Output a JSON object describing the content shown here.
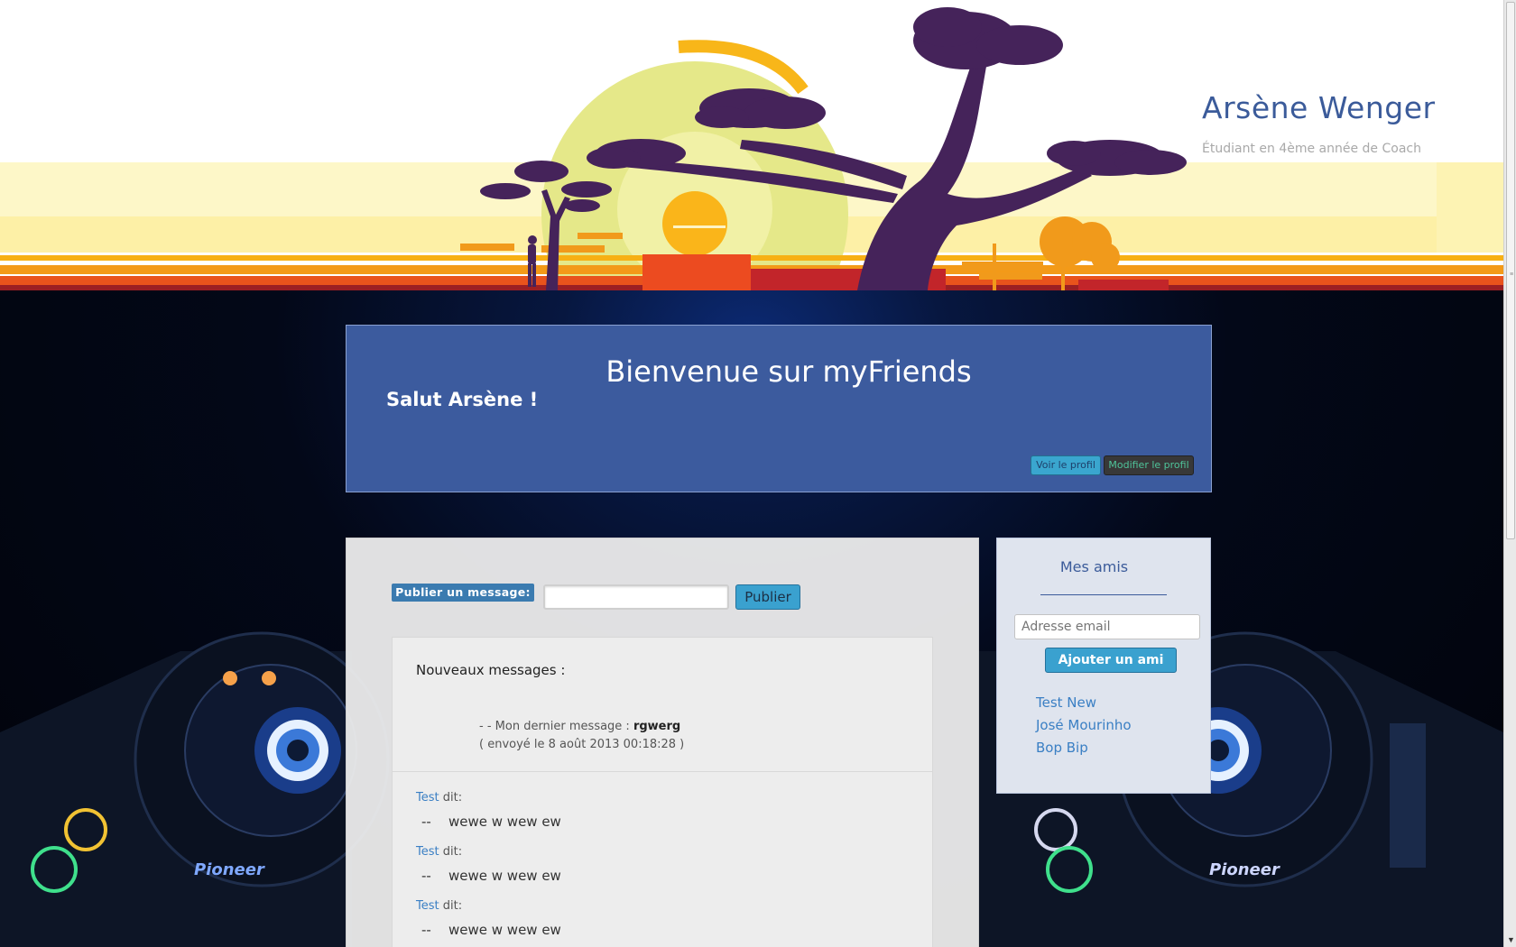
{
  "header": {
    "name": "Arsène Wenger",
    "subtitle": "Étudiant en 4ème année de Coach"
  },
  "welcome": {
    "title": "Bienvenue sur myFriends",
    "greeting": "Salut Arsène !",
    "view_profile": "Voir le profil",
    "edit_profile": "Modifier le profil"
  },
  "feed": {
    "publish_label": "Publier un message:",
    "publish_input_value": "",
    "publish_button": "Publier",
    "new_messages_title": "Nouveaux messages :",
    "last_message_prefix": "- - Mon dernier message : ",
    "last_message_text": "rgwerg",
    "last_message_date": "( envoyé le 8 août 2013 00:18:28 )",
    "posts": [
      {
        "author": "Test",
        "says": " dit:",
        "dash": "--",
        "body": "wewe w wew ew"
      },
      {
        "author": "Test",
        "says": " dit:",
        "dash": "--",
        "body": "wewe w wew ew"
      },
      {
        "author": "Test",
        "says": " dit:",
        "dash": "--",
        "body": "wewe w wew ew"
      }
    ]
  },
  "friends": {
    "title": "Mes amis",
    "email_placeholder": "Adresse email",
    "add_button": "Ajouter un ami",
    "list": [
      "Test New",
      "José Mourinho",
      "Bop Bip"
    ]
  },
  "colors": {
    "brand_blue": "#3c5b9e",
    "accent_button": "#3aa1cf",
    "link": "#3a7fc4"
  }
}
